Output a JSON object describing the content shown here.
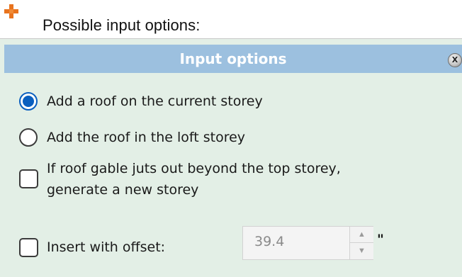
{
  "header": {
    "icon": "plus-icon",
    "text": "Possible input options:"
  },
  "dialog": {
    "title": "Input options",
    "close_label": "X",
    "options": {
      "roof_current": {
        "label": "Add a roof on the current storey",
        "type": "radio",
        "checked": true
      },
      "roof_loft": {
        "label": "Add the roof in the loft storey",
        "type": "radio",
        "checked": false
      },
      "new_storey": {
        "label_line1": "If roof gable juts out beyond the top storey,",
        "label_line2": "generate a new storey",
        "type": "checkbox",
        "checked": false
      },
      "insert_offset": {
        "label": "Insert with offset:",
        "type": "checkbox",
        "checked": false
      }
    },
    "offset_field": {
      "value": "39.4",
      "unit": "\"",
      "up_icon": "triangle-up-icon",
      "down_icon": "triangle-down-icon"
    }
  },
  "colors": {
    "title_bar": "#9cc0df",
    "dialog_bg": "#e3efe6",
    "radio_accent": "#0a5fbf",
    "icon_orange": "#e8731e"
  }
}
